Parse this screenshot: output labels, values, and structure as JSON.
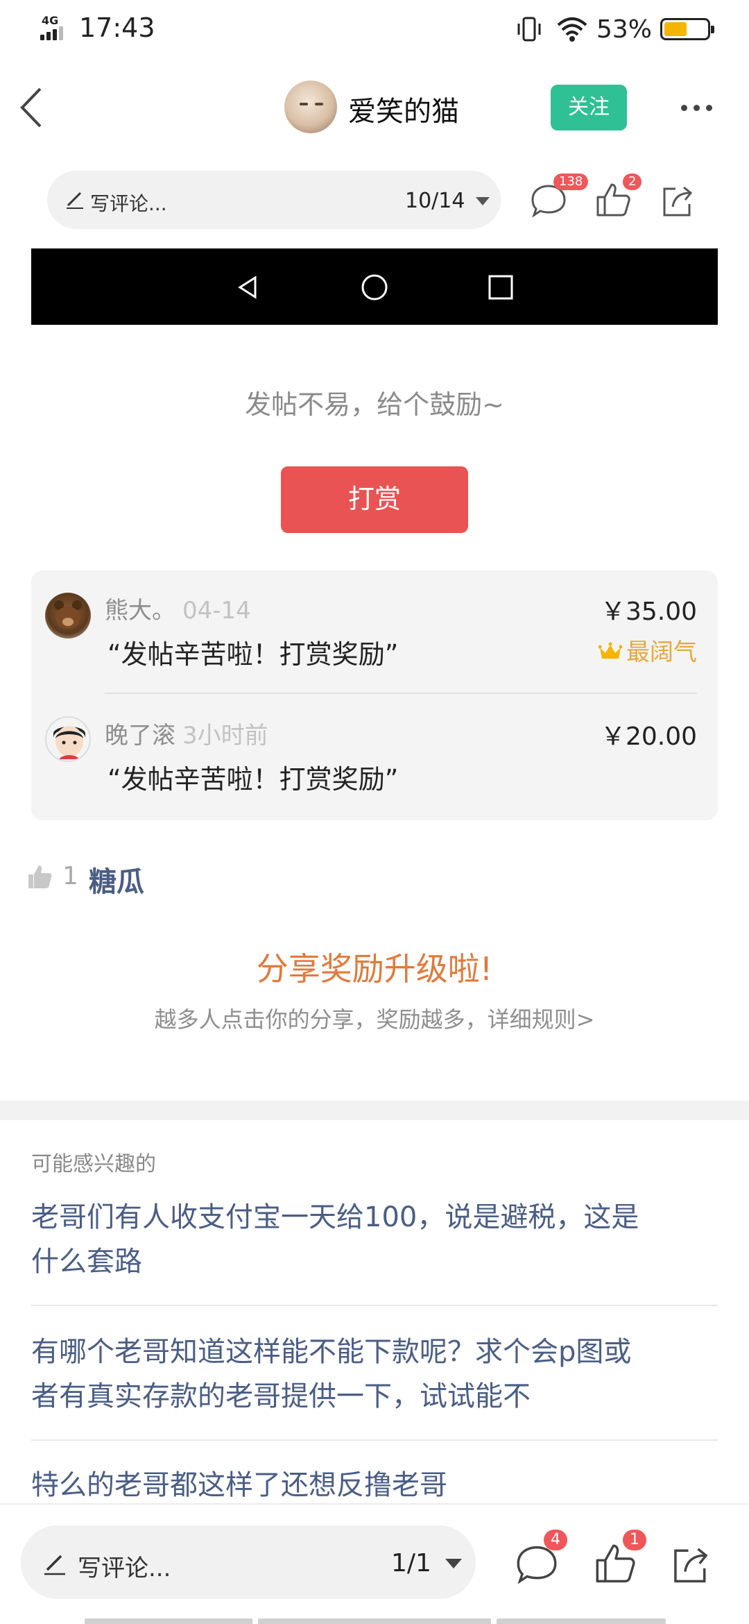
{
  "status_bar": {
    "network": "4G",
    "time": "17:43",
    "battery_percent": "53%",
    "battery_level": 0.53
  },
  "header": {
    "author_name": "爱笑的猫",
    "follow_label": "关注"
  },
  "comment_bar_top": {
    "placeholder": "写评论...",
    "page": "10/14",
    "comment_count": "138",
    "like_count": "2"
  },
  "reward": {
    "encourage_text": "发帖不易，给个鼓励~",
    "tip_button": "打赏",
    "records": [
      {
        "name": "熊大。",
        "time": "04-14",
        "message": "“发帖辛苦啦！打赏奖励”",
        "amount": "￥35.00",
        "tag": "最阔气"
      },
      {
        "name": "晚了滚",
        "time": "3小时前",
        "message": "“发帖辛苦啦！打赏奖励”",
        "amount": "￥20.00"
      }
    ]
  },
  "likes": {
    "count": "1",
    "user": "糖瓜"
  },
  "share_promo": {
    "title": "分享奖励升级啦!",
    "subtitle": "越多人点击你的分享，奖励越多，详细规则>"
  },
  "recommendations": {
    "heading": "可能感兴趣的",
    "items": [
      {
        "line1": "老哥们有人收支付宝一天给100，说是避税，这是",
        "line2": "什么套路"
      },
      {
        "line1": "有哪个老哥知道这样能不能下款呢？求个会p图或",
        "line2": "者有真实存款的老哥提供一下，试试能不"
      },
      {
        "line1": "特么的老哥都这样了还想反撸老哥"
      }
    ]
  },
  "comment_bar_bottom": {
    "placeholder": "写评论...",
    "page": "1/1",
    "comment_count": "4",
    "like_count": "1"
  },
  "colors": {
    "follow": "#2fc096",
    "tip": "#e95353",
    "promo": "#e07a3b",
    "link": "#4a5d85",
    "badge": "#f0575a",
    "crown": "#f5b400"
  }
}
